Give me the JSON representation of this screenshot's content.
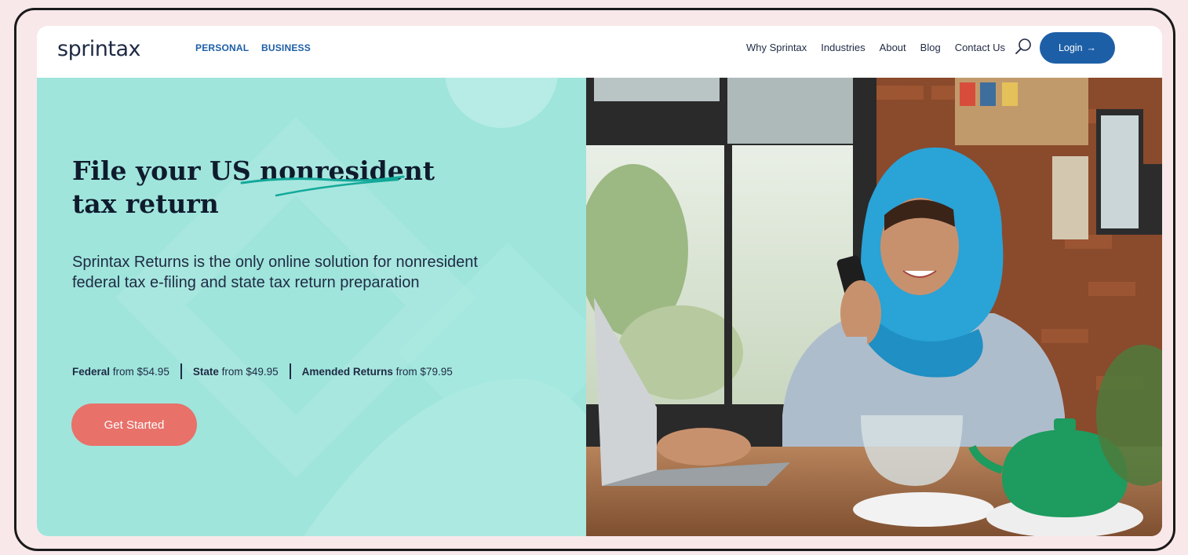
{
  "nav": {
    "logo": "sprintax",
    "segments": [
      "PERSONAL",
      "BUSINESS"
    ],
    "links": [
      "Why Sprintax",
      "Industries",
      "About",
      "Blog",
      "Contact Us"
    ],
    "login_label": "Login",
    "login_arrow": "→"
  },
  "hero": {
    "title_part1": "File your US ",
    "title_highlight": "nonresident",
    "title_part2": "tax return",
    "description": "Sprintax Returns is the only online solution for nonresident federal tax e-filing and state tax return preparation",
    "pricing": [
      {
        "label": "Federal",
        "text": " from $54.95"
      },
      {
        "label": "State",
        "text": " from $49.95"
      },
      {
        "label": "Amended Returns",
        "text": " from $79.95"
      }
    ],
    "cta_label": "Get Started"
  },
  "colors": {
    "page_bg": "#f8e8ea",
    "hero_bg": "#9fe5dc",
    "brand_blue": "#1d5fa7",
    "cta": "#e8716a"
  },
  "icons": {
    "search": "search-icon",
    "logo_mark": "sparkle-x-icon"
  }
}
